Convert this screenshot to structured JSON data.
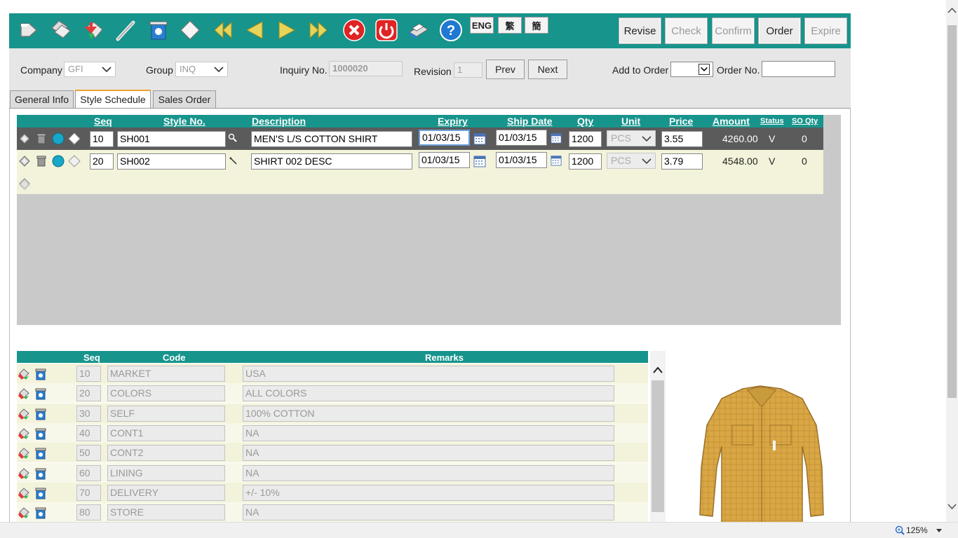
{
  "toolbar": {
    "icons": [
      "new-icon",
      "copy-icon",
      "save-icon",
      "edit-icon",
      "delete-icon",
      "blank-icon",
      "first-icon",
      "prev-icon",
      "next-icon",
      "last-icon",
      "cancel-icon",
      "power-icon",
      "print-icon",
      "help-icon"
    ],
    "languages": [
      "ENG",
      "繁",
      "簡"
    ],
    "actions": [
      {
        "label": "Revise",
        "enabled": true
      },
      {
        "label": "Check",
        "enabled": false
      },
      {
        "label": "Confirm",
        "enabled": false
      },
      {
        "label": "Order",
        "enabled": true
      },
      {
        "label": "Expire",
        "enabled": false
      }
    ]
  },
  "header": {
    "company_label": "Company",
    "company_value": "GFI",
    "group_label": "Group",
    "group_value": "INQ",
    "inquiry_label": "Inquiry No.",
    "inquiry_value": "1000020",
    "revision_label": "Revision",
    "revision_value": "1",
    "prev_label": "Prev",
    "next_label": "Next",
    "add_to_order_label": "Add to Order",
    "add_to_order_value": "",
    "order_no_label": "Order No.",
    "order_no_value": ""
  },
  "tabs": [
    {
      "label": "General Info",
      "active": false
    },
    {
      "label": "Style Schedule",
      "active": true
    },
    {
      "label": "Sales Order",
      "active": false
    }
  ],
  "style_grid": {
    "columns": [
      "Seq",
      "Style No.",
      "Description",
      "Expiry",
      "Ship Date",
      "Qty",
      "Unit",
      "Price",
      "Amount",
      "Status",
      "SO Qty"
    ],
    "rows": [
      {
        "seq": "10",
        "style_no": "SH001",
        "description": "MEN'S L/S COTTON SHIRT",
        "expiry": "01/03/15",
        "ship_date": "01/03/15",
        "qty": "1200",
        "unit": "PCS",
        "price": "3.55",
        "amount": "4260.00",
        "status": "V",
        "so_qty": "0"
      },
      {
        "seq": "20",
        "style_no": "SH002",
        "description": "SHIRT 002 DESC",
        "expiry": "01/03/15",
        "ship_date": "01/03/15",
        "qty": "1200",
        "unit": "PCS",
        "price": "3.79",
        "amount": "4548.00",
        "status": "V",
        "so_qty": "0"
      }
    ]
  },
  "remarks_grid": {
    "columns": [
      "Seq",
      "Code",
      "Remarks"
    ],
    "rows": [
      {
        "seq": "10",
        "code": "MARKET",
        "remarks": "USA"
      },
      {
        "seq": "20",
        "code": "COLORS",
        "remarks": "ALL COLORS"
      },
      {
        "seq": "30",
        "code": "SELF",
        "remarks": "100% COTTON"
      },
      {
        "seq": "40",
        "code": "CONT1",
        "remarks": "NA"
      },
      {
        "seq": "50",
        "code": "CONT2",
        "remarks": "NA"
      },
      {
        "seq": "60",
        "code": "LINING",
        "remarks": "NA"
      },
      {
        "seq": "70",
        "code": "DELIVERY",
        "remarks": "+/- 10%"
      },
      {
        "seq": "80",
        "code": "STORE",
        "remarks": "NA"
      }
    ]
  },
  "statusbar": {
    "zoom": "125%"
  },
  "colors": {
    "teal": "#17948c",
    "selected_row": "#5b5b5b",
    "row_bg": "#f3f3dc"
  }
}
